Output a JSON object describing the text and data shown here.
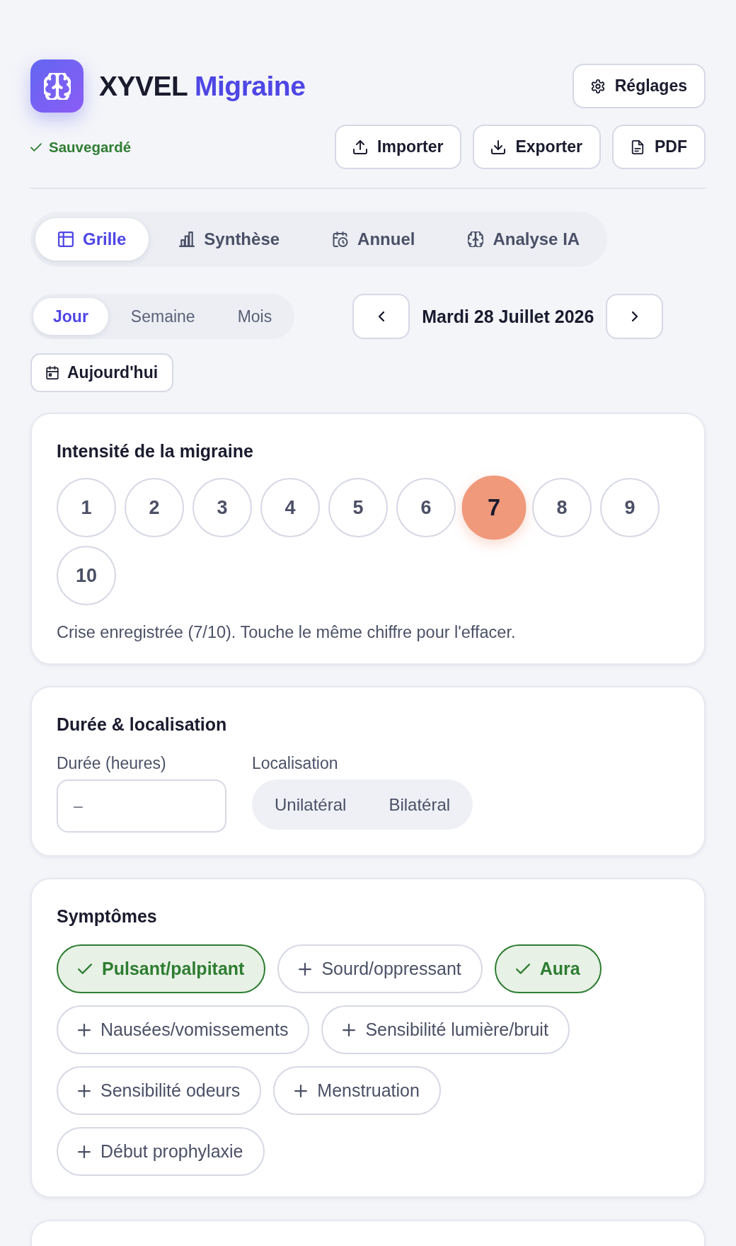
{
  "header": {
    "title": {
      "brand": "XYVEL",
      "product": "Migraine"
    },
    "save_status": "Sauvegardé",
    "settings_button": "Réglages",
    "actions": [
      {
        "kind": "import",
        "label": "Importer"
      },
      {
        "kind": "export",
        "label": "Exporter"
      },
      {
        "kind": "pdf",
        "label": "PDF"
      }
    ]
  },
  "tabs": [
    {
      "kind": "grid",
      "label": "Grille",
      "selected": true
    },
    {
      "kind": "summary",
      "label": "Synthèse",
      "selected": false
    },
    {
      "kind": "annual",
      "label": "Annuel",
      "selected": false
    },
    {
      "kind": "ai",
      "label": "Analyse IA",
      "selected": false
    }
  ],
  "view_modes": [
    {
      "label": "Jour",
      "selected": true
    },
    {
      "label": "Semaine",
      "selected": false
    },
    {
      "label": "Mois",
      "selected": false
    }
  ],
  "date_nav": {
    "date": "Mardi 28 Juillet 2026"
  },
  "today_button": "Aujourd'hui",
  "intensity": {
    "title": "Intensité de la migraine",
    "levels": [
      {
        "label": "1",
        "selected": false
      },
      {
        "label": "2",
        "selected": false
      },
      {
        "label": "3",
        "selected": false
      },
      {
        "label": "4",
        "selected": false
      },
      {
        "label": "5",
        "selected": false
      },
      {
        "label": "6",
        "selected": false
      },
      {
        "label": "7",
        "selected": true
      },
      {
        "label": "8",
        "selected": false
      },
      {
        "label": "9",
        "selected": false
      },
      {
        "label": "10",
        "selected": false
      }
    ],
    "note": "Crise enregistrée (7/10). Touche le même chiffre pour l'effacer."
  },
  "duration_location": {
    "title": "Durée & localisation",
    "duration": {
      "label": "Durée (heures)",
      "placeholder": "–"
    },
    "location": {
      "label": "Localisation",
      "options": [
        {
          "label": "Unilatéral",
          "selected": false
        },
        {
          "label": "Bilatéral",
          "selected": false
        }
      ]
    }
  },
  "symptoms": {
    "title": "Symptômes",
    "items": [
      {
        "label": "Pulsant/palpitant",
        "selected": true
      },
      {
        "label": "Sourd/oppressant",
        "selected": false
      },
      {
        "label": "Aura",
        "selected": true
      },
      {
        "label": "Nausées/vomissements",
        "selected": false
      },
      {
        "label": "Sensibilité lumière/bruit",
        "selected": false
      },
      {
        "label": "Sensibilité odeurs",
        "selected": false
      },
      {
        "label": "Menstruation",
        "selected": false
      },
      {
        "label": "Début prophylaxie",
        "selected": false
      }
    ]
  }
}
